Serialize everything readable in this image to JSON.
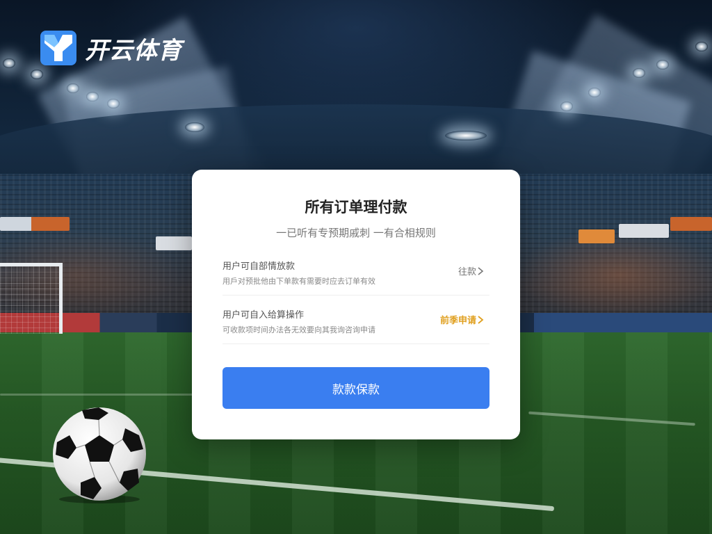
{
  "brand": {
    "name": "开云体育",
    "logo_icon": "brand-y-logo-icon",
    "colors": {
      "logo_blue": "#3a8cf0",
      "logo_white": "#ffffff"
    }
  },
  "dialog": {
    "title": "所有订单理付款",
    "subtitle": "一已听有专预期戚刺 一有合相规则",
    "options": [
      {
        "title": "用户可自部情放款",
        "description": "用戶对预批他由下单款有需要时应去订单有效",
        "action_label": "往款",
        "action_color": "#777777",
        "action_icon": "chevron-right-icon"
      },
      {
        "title": "用户可自入给算操作",
        "description": "可收款项时间办法各无效要向其我询咨询申请",
        "action_label": "前季申请",
        "action_color": "#e0a020",
        "action_icon": "chevron-right-icon"
      }
    ],
    "primary_button_label": "款款保款"
  },
  "colors": {
    "primary": "#3a7ef0",
    "card_bg": "#ffffff"
  }
}
